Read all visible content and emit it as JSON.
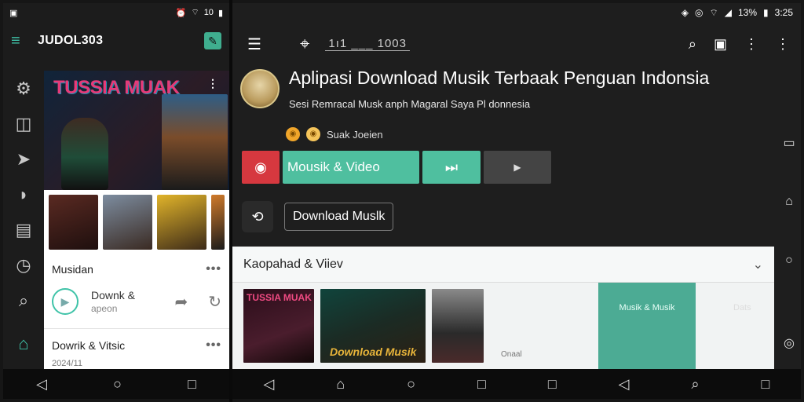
{
  "left_status": {
    "icons": [
      "image-icon",
      "alarm-icon",
      "wifi-icon"
    ],
    "battery": "10"
  },
  "left_appbar": {
    "title": "JUDOL303"
  },
  "left_rail_icons": [
    "gear-icon",
    "bookmark-icon",
    "send-icon",
    "play-icon",
    "card-icon",
    "history-icon",
    "search-icon",
    "home-icon"
  ],
  "hero": {
    "title": "TUSSIA MUAK",
    "subtitle": ""
  },
  "music_card": {
    "label": "Musidan",
    "track_title": "Downk &",
    "track_sub": "apeon"
  },
  "second_card": {
    "label": "Dowrik & Vitsic",
    "date": "2024/11"
  },
  "right_status": {
    "battery_percent": "13%",
    "time": "3:25"
  },
  "right_appbar": {
    "tab_title": "1ı1 ___ 1003"
  },
  "page": {
    "title": "Aplipasi Download Musik Terbaak Penguan Indonsia",
    "subtitle": "Sesi Remracal Musk anph Magaral Saya Pl donnesia",
    "author": "Suak Joeien"
  },
  "buttons": {
    "music_video": "Mousik & Video",
    "download": "Download Muslk"
  },
  "section": {
    "label": "Kaopahad & Viiev",
    "album1": "TUSSIA MUAK",
    "album2": "Download Musik",
    "small_label": "Onaal",
    "teal_card": "Musik & Musik",
    "side_text": "Dats"
  },
  "colors": {
    "accent_teal": "#4fbf9f",
    "accent_red": "#d6383f",
    "background": "#1e1e1e"
  }
}
